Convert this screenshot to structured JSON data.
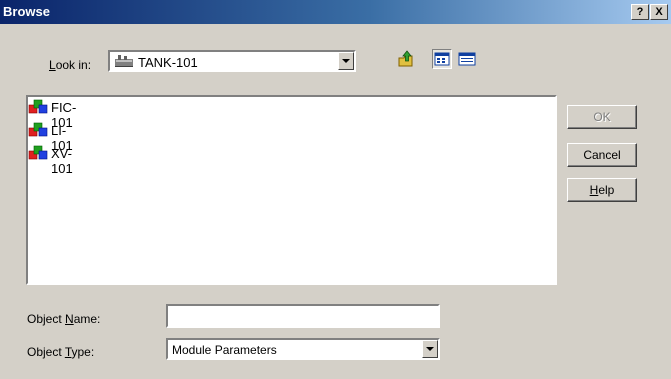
{
  "window": {
    "title": "Browse",
    "help_glyph": "?",
    "close_glyph": "X"
  },
  "lookin": {
    "label_pre": "",
    "label_key": "L",
    "label_post": "ook in:",
    "value": "TANK-101",
    "icon": "plant-equipment-icon"
  },
  "toolbar": {
    "up_icon": "up-folder-icon",
    "list_icon": "list-view-icon",
    "detail_icon": "details-view-icon"
  },
  "files": [
    {
      "label": "FIC-101",
      "icon": "module-icon"
    },
    {
      "label": "LI-101",
      "icon": "module-icon"
    },
    {
      "label": "XV-101",
      "icon": "module-icon"
    }
  ],
  "buttons": {
    "ok": "OK",
    "cancel": "Cancel",
    "help_key": "H",
    "help_rest": "elp"
  },
  "object_name": {
    "label_pre": "Object ",
    "label_key": "N",
    "label_post": "ame:",
    "value": ""
  },
  "object_type": {
    "label_pre": "Object ",
    "label_key": "T",
    "label_post": "ype:",
    "value": "Module Parameters"
  },
  "colors": {
    "title_start": "#0a246a",
    "title_end": "#a6caf0",
    "face": "#d4d0c8"
  }
}
